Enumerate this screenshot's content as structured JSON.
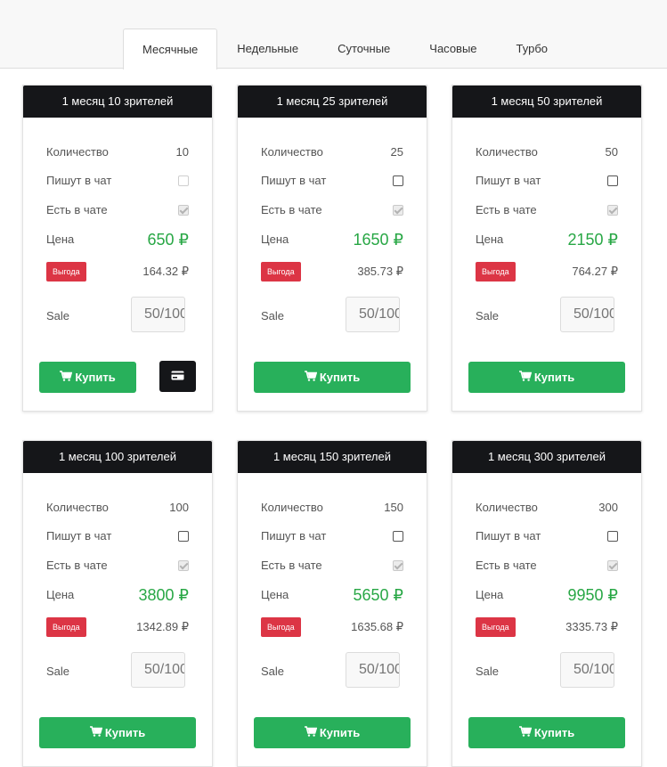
{
  "tabs": [
    {
      "label": "Месячные",
      "active": true
    },
    {
      "label": "Недельные",
      "active": false
    },
    {
      "label": "Суточные",
      "active": false
    },
    {
      "label": "Часовые",
      "active": false
    },
    {
      "label": "Турбо",
      "active": false
    }
  ],
  "labels": {
    "quantity": "Количество",
    "write_chat": "Пишут в чат",
    "in_chat": "Есть в чате",
    "price": "Цена",
    "badge": "Выгода",
    "sale": "Sale",
    "buy": "Купить"
  },
  "colors": {
    "price": "#28a745",
    "badge": "#dc3545",
    "buy_button": "#28b05b",
    "header": "#151619"
  },
  "cards": [
    {
      "title": "1 месяц 10 зрителей",
      "quantity": "10",
      "price": "650 ₽",
      "per_unit": "164.32 ₽",
      "sale_placeholder": "50/100",
      "write_chat_checked": false,
      "in_chat_checked": true,
      "has_card_button": true
    },
    {
      "title": "1 месяц 25 зрителей",
      "quantity": "25",
      "price": "1650 ₽",
      "per_unit": "385.73 ₽",
      "sale_placeholder": "50/100",
      "write_chat_checked": false,
      "in_chat_checked": true,
      "has_card_button": false
    },
    {
      "title": "1 месяц 50 зрителей",
      "quantity": "50",
      "price": "2150 ₽",
      "per_unit": "764.27 ₽",
      "sale_placeholder": "50/100",
      "write_chat_checked": false,
      "in_chat_checked": true,
      "has_card_button": false
    },
    {
      "title": "1 месяц 100 зрителей",
      "quantity": "100",
      "price": "3800 ₽",
      "per_unit": "1342.89 ₽",
      "sale_placeholder": "50/100",
      "write_chat_checked": false,
      "in_chat_checked": true,
      "has_card_button": false
    },
    {
      "title": "1 месяц 150 зрителей",
      "quantity": "150",
      "price": "5650 ₽",
      "per_unit": "1635.68 ₽",
      "sale_placeholder": "50/100",
      "write_chat_checked": false,
      "in_chat_checked": true,
      "has_card_button": false
    },
    {
      "title": "1 месяц 300 зрителей",
      "quantity": "300",
      "price": "9950 ₽",
      "per_unit": "3335.73 ₽",
      "sale_placeholder": "50/100",
      "write_chat_checked": false,
      "in_chat_checked": true,
      "has_card_button": false
    }
  ],
  "icons": {
    "cart": "shopping-cart-icon",
    "card": "credit-card-icon"
  }
}
